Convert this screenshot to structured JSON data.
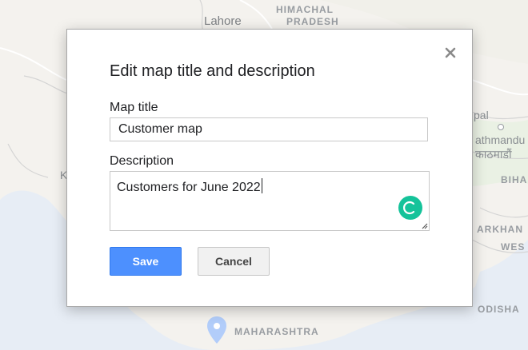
{
  "map": {
    "labels": {
      "lahore": "Lahore",
      "himachal": "HIMACHAL",
      "pradesh": "PRADESH",
      "nepal_partial": "pal",
      "kathmandu": "athmandu",
      "kathmandu_devanagari": "काठमाडौं",
      "bihar_partial": "BIHA",
      "jharkhand_partial": "ARKHAN",
      "west_partial": "WES",
      "odisha": "ODISHA",
      "maharashtra": "MAHARASHTRA",
      "k_partial": "K"
    }
  },
  "dialog": {
    "title": "Edit map title and description",
    "close_icon": "close-icon",
    "map_title_label": "Map title",
    "map_title_value": "Customer map",
    "description_label": "Description",
    "description_value": "Customers for June 2022",
    "save_label": "Save",
    "cancel_label": "Cancel"
  },
  "colors": {
    "save_button": "#4d90fe",
    "assistant_badge": "#15c39a",
    "land": "#f2f0ea",
    "water": "#e3ebf6",
    "border": "#b8b8b8"
  }
}
